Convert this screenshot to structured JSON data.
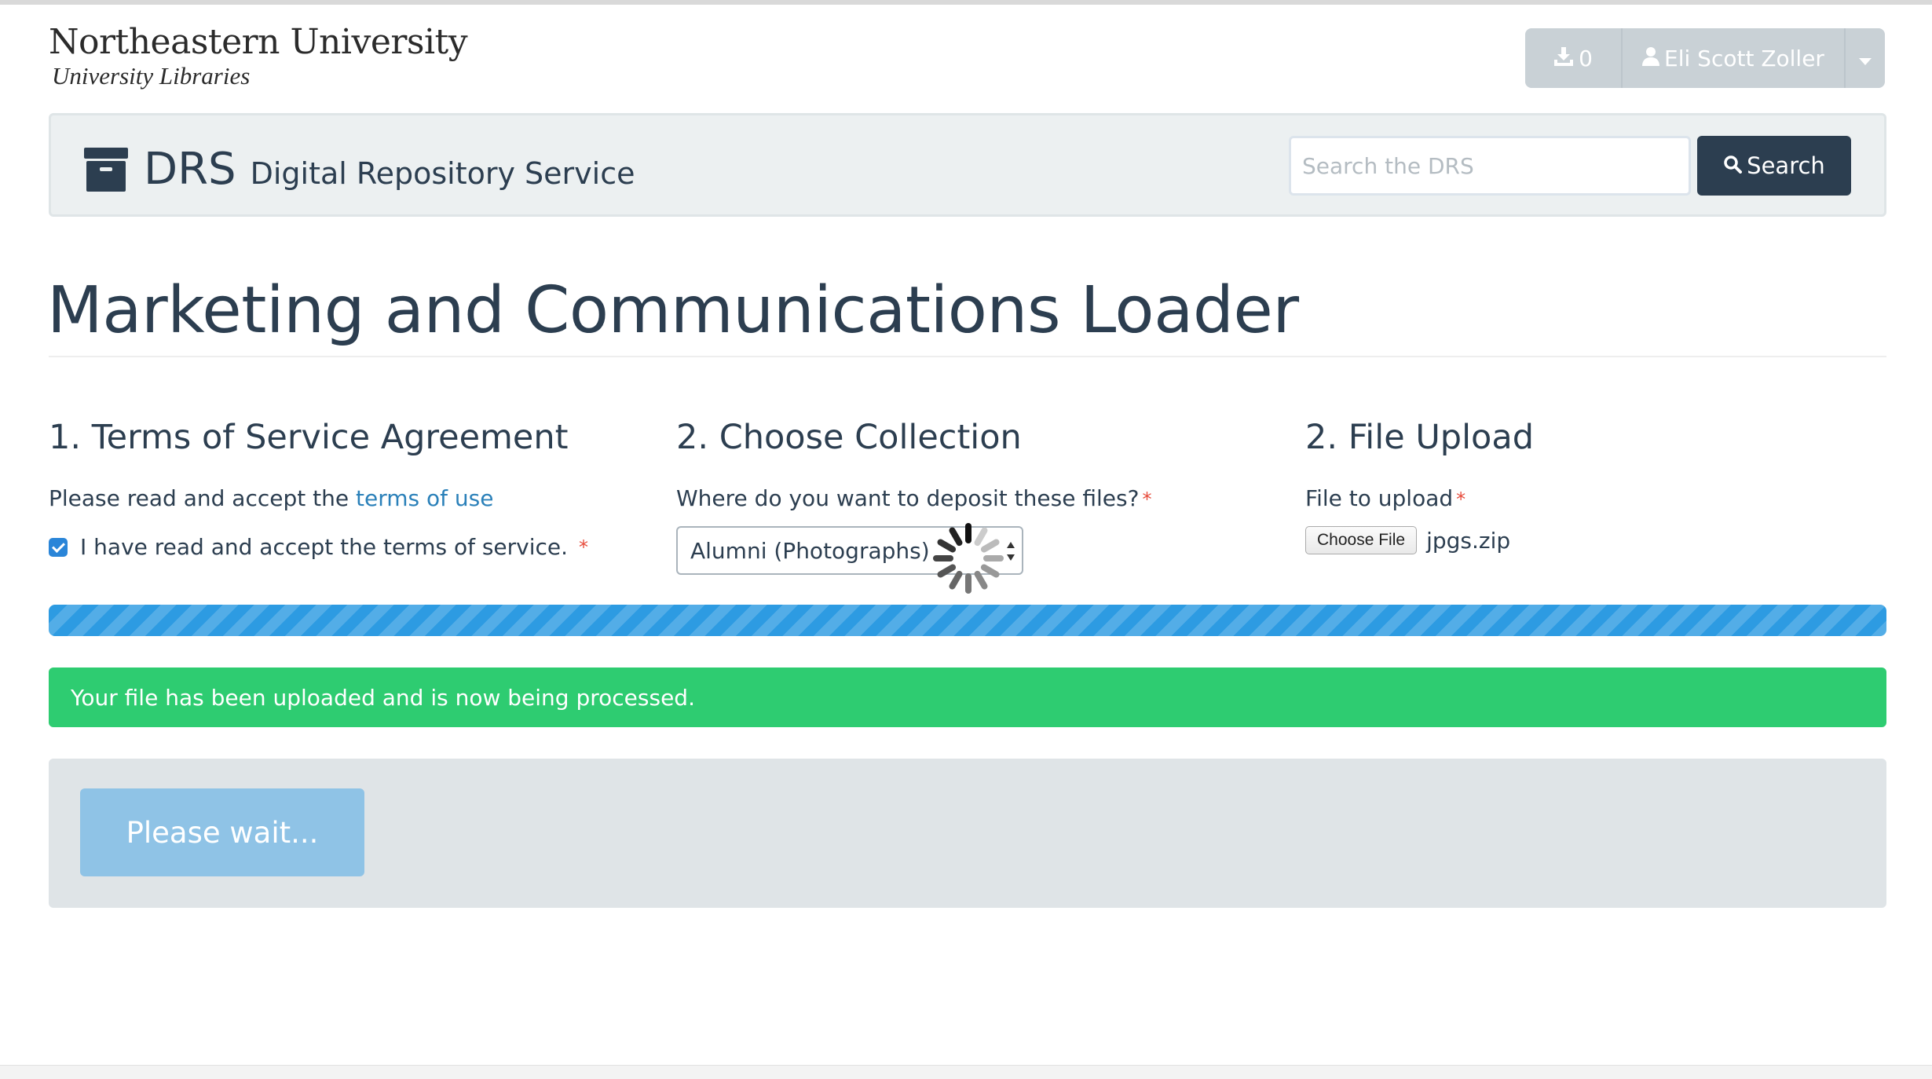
{
  "university": {
    "name": "Northeastern University",
    "subtitle": "University Libraries"
  },
  "user_menu": {
    "download_count": "0",
    "user_name": "Eli Scott Zoller",
    "download_icon": "download-icon",
    "user_icon": "user-icon",
    "caret_icon": "caret-down-icon"
  },
  "header": {
    "logo_icon": "archive-box-icon",
    "title": "DRS",
    "subtitle": "Digital Repository Service",
    "search_placeholder": "Search the DRS",
    "search_label": "Search",
    "search_icon": "search-icon"
  },
  "page": {
    "title": "Marketing and Communications Loader"
  },
  "terms": {
    "heading": "1. Terms of Service Agreement",
    "lead_text": "Please read and accept the ",
    "link_text": "terms of use",
    "checkbox_label": "I have read and accept the terms of service.",
    "required_mark": "*",
    "checked": true
  },
  "collection": {
    "heading": "2. Choose Collection",
    "label": "Where do you want to deposit these files?",
    "required_mark": "*",
    "selected": "Alumni (Photographs)"
  },
  "upload": {
    "heading": "2. File Upload",
    "label": "File to upload",
    "required_mark": "*",
    "button_label": "Choose File",
    "file_name": "jpgs.zip"
  },
  "progress": {
    "fraction": 1.0,
    "color": "#2d9be2"
  },
  "alert": {
    "message": "Your file has been uploaded and is now being processed.",
    "color": "#2ecc71"
  },
  "actions": {
    "wait_label": "Please wait..."
  },
  "colors": {
    "primary": "#2c3e50",
    "link": "#2a80b9",
    "required": "#e74c3c"
  }
}
